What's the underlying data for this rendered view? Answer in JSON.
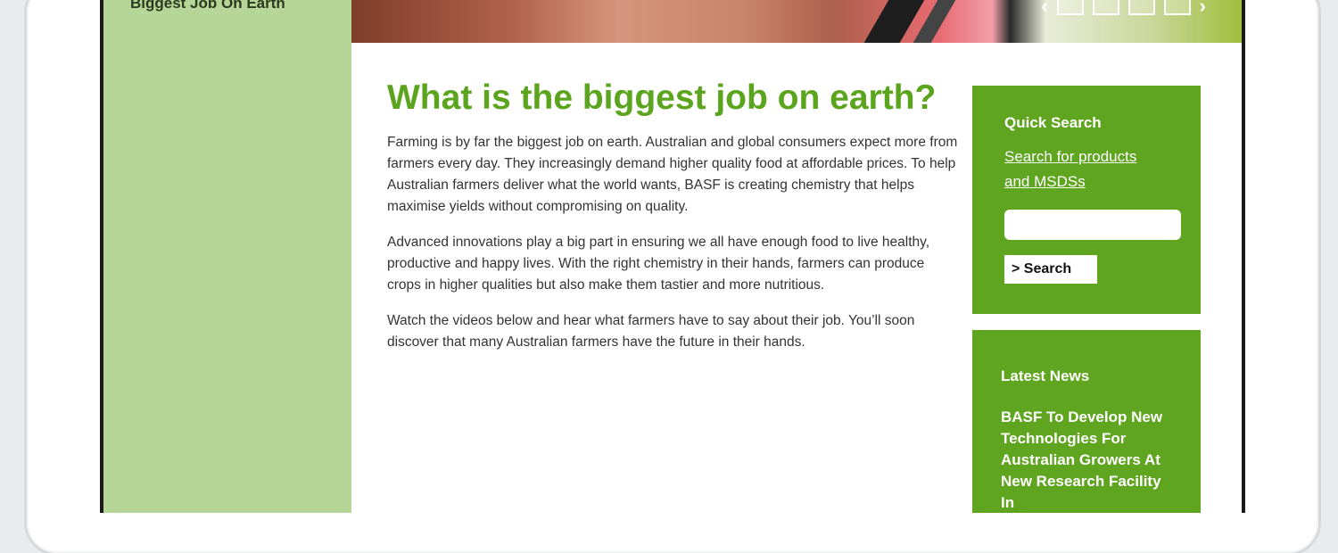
{
  "left_nav": {
    "label": "Biggest Job On Earth"
  },
  "main": {
    "title": "What is the biggest job on earth?",
    "paragraphs": [
      "Farming is by far the biggest job on earth. Australian and global consumers expect more from farmers every day. They increasingly demand higher quality food at affordable prices. To help Australian farmers deliver what the world wants, BASF is creating chemistry that helps maximise yields without compromising on quality.",
      "Advanced innovations play a big part in ensuring we all have enough food to live healthy, productive and happy lives. With the right chemistry in their hands, farmers can produce crops in higher qualities but also make them tastier and more nutritious.",
      "Watch the videos below and hear what farmers have to say about their job. You’ll soon discover that many Australian farmers have the future in their hands."
    ]
  },
  "quick_search": {
    "title": "Quick Search",
    "link_text": "Search for products and MSDSs",
    "input_value": "",
    "button_label": "> Search"
  },
  "latest_news": {
    "title": "Latest News",
    "headline": "BASF To Develop New Technologies For Australian Growers At New Research Facility In"
  },
  "banner": {
    "prev_arrow": "‹",
    "next_arrow": "›"
  },
  "colors": {
    "accent_green": "#5fa520",
    "light_green": "#b5d696",
    "title_green": "#5aa51d"
  }
}
